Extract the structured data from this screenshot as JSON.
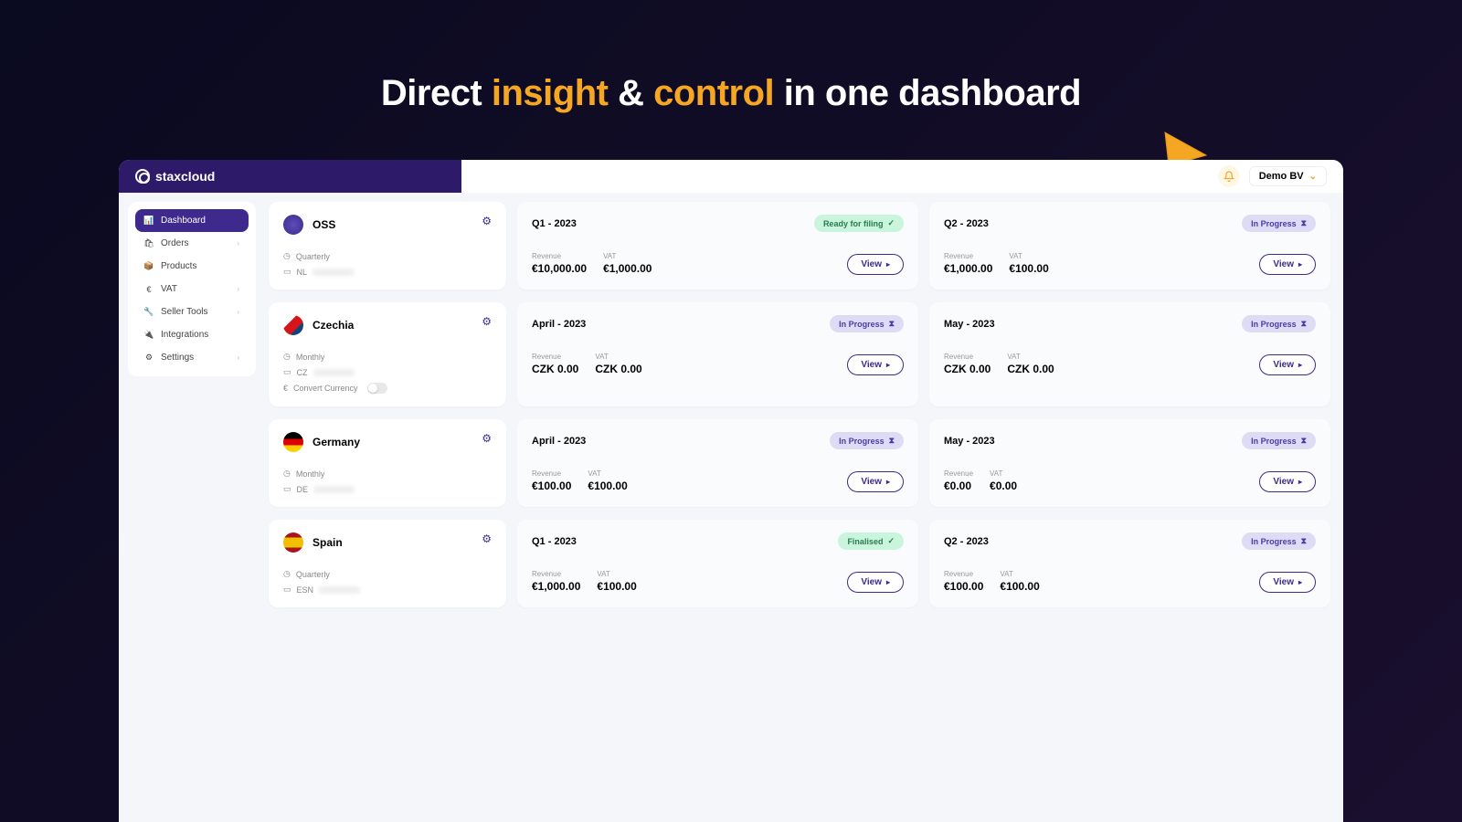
{
  "hero": {
    "pre": "Direct ",
    "accent1": "insight",
    "mid": " & ",
    "accent2": "control",
    "post": " in one dashboard"
  },
  "brand": "staxcloud",
  "company": "Demo BV",
  "sidebar": {
    "items": [
      {
        "icon": "📊",
        "label": "Dashboard",
        "hasCaret": false
      },
      {
        "icon": "🛍",
        "label": "Orders",
        "hasCaret": true
      },
      {
        "icon": "📦",
        "label": "Products",
        "hasCaret": false
      },
      {
        "icon": "€",
        "label": "VAT",
        "hasCaret": true
      },
      {
        "icon": "🔧",
        "label": "Seller Tools",
        "hasCaret": true
      },
      {
        "icon": "🔌",
        "label": "Integrations",
        "hasCaret": false
      },
      {
        "icon": "⚙",
        "label": "Settings",
        "hasCaret": true
      }
    ]
  },
  "labels": {
    "revenue": "Revenue",
    "vat": "VAT",
    "view": "View",
    "convertCurrency": "Convert Currency"
  },
  "statuses": {
    "ready": "Ready for filing",
    "progress": "In Progress",
    "finalised": "Finalised"
  },
  "regions": [
    {
      "name": "OSS",
      "flag": "oss",
      "freq": "Quarterly",
      "code": "NL",
      "showConvert": false,
      "periods": [
        {
          "title": "Q1 - 2023",
          "status": "ready",
          "revenue": "€10,000.00",
          "vat": "€1,000.00"
        },
        {
          "title": "Q2 - 2023",
          "status": "progress",
          "revenue": "€1,000.00",
          "vat": "€100.00"
        }
      ]
    },
    {
      "name": "Czechia",
      "flag": "cz",
      "freq": "Monthly",
      "code": "CZ",
      "showConvert": true,
      "periods": [
        {
          "title": "April - 2023",
          "status": "progress",
          "revenue": "CZK 0.00",
          "vat": "CZK 0.00"
        },
        {
          "title": "May - 2023",
          "status": "progress",
          "revenue": "CZK 0.00",
          "vat": "CZK 0.00"
        }
      ]
    },
    {
      "name": "Germany",
      "flag": "de",
      "freq": "Monthly",
      "code": "DE",
      "showConvert": false,
      "periods": [
        {
          "title": "April - 2023",
          "status": "progress",
          "revenue": "€100.00",
          "vat": "€100.00"
        },
        {
          "title": "May - 2023",
          "status": "progress",
          "revenue": "€0.00",
          "vat": "€0.00"
        }
      ]
    },
    {
      "name": "Spain",
      "flag": "es",
      "freq": "Quarterly",
      "code": "ESN",
      "showConvert": false,
      "periods": [
        {
          "title": "Q1 - 2023",
          "status": "finalised",
          "revenue": "€1,000.00",
          "vat": "€100.00"
        },
        {
          "title": "Q2 - 2023",
          "status": "progress",
          "revenue": "€100.00",
          "vat": "€100.00"
        }
      ]
    }
  ]
}
